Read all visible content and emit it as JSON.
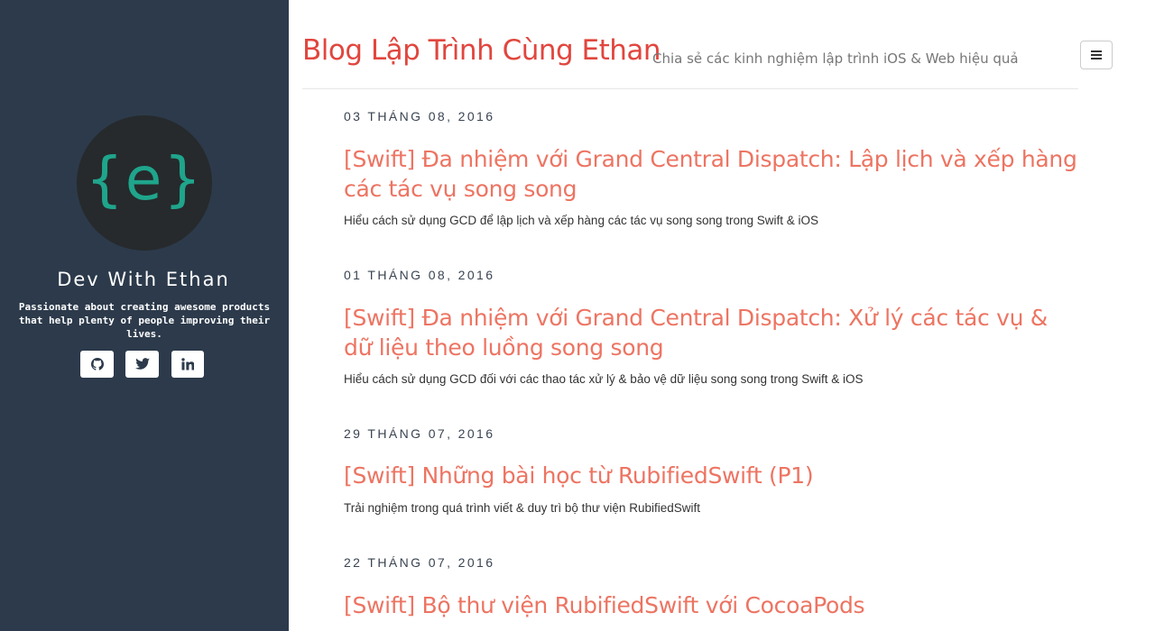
{
  "sidebar": {
    "logo_text": "{e}",
    "site_name": "Dev With Ethan",
    "tagline": "Passionate about creating awesome products that help plenty of people improving their lives.",
    "social": [
      "github-icon",
      "twitter-icon",
      "linkedin-icon"
    ]
  },
  "header": {
    "title": "Blog Lập Trình Cùng Ethan",
    "subtitle": "Chia sẻ các kinh nghiệm lập trình iOS & Web hiệu quả",
    "menu_icon": "hamburger-menu-icon"
  },
  "posts": [
    {
      "date": "03 THÁNG 08, 2016",
      "title": "[Swift] Đa nhiệm với Grand Central Dispatch: Lập lịch và xếp hàng các tác vụ song song",
      "description": "Hiểu cách sử dụng GCD để lập lịch và xếp hàng các tác vụ song song trong Swift & iOS"
    },
    {
      "date": "01 THÁNG 08, 2016",
      "title": "[Swift] Đa nhiệm với Grand Central Dispatch: Xử lý các tác vụ & dữ liệu theo luồng song song",
      "description": "Hiểu cách sử dụng GCD đối với các thao tác xử lý & bảo vệ dữ liệu song song trong Swift & iOS"
    },
    {
      "date": "29 THÁNG 07, 2016",
      "title": "[Swift] Những bài học từ RubifiedSwift (P1)",
      "description": "Trải nghiệm trong quá trình viết & duy trì bộ thư viện RubifiedSwift"
    },
    {
      "date": "22 THÁNG 07, 2016",
      "title": "[Swift] Bộ thư viện RubifiedSwift với CocoaPods",
      "description": ""
    }
  ],
  "colors": {
    "sidebar_bg": "#2c3a4b",
    "brand_title": "#e1463e",
    "post_title": "#ed7462",
    "logo_accent": "#1fa58c"
  }
}
